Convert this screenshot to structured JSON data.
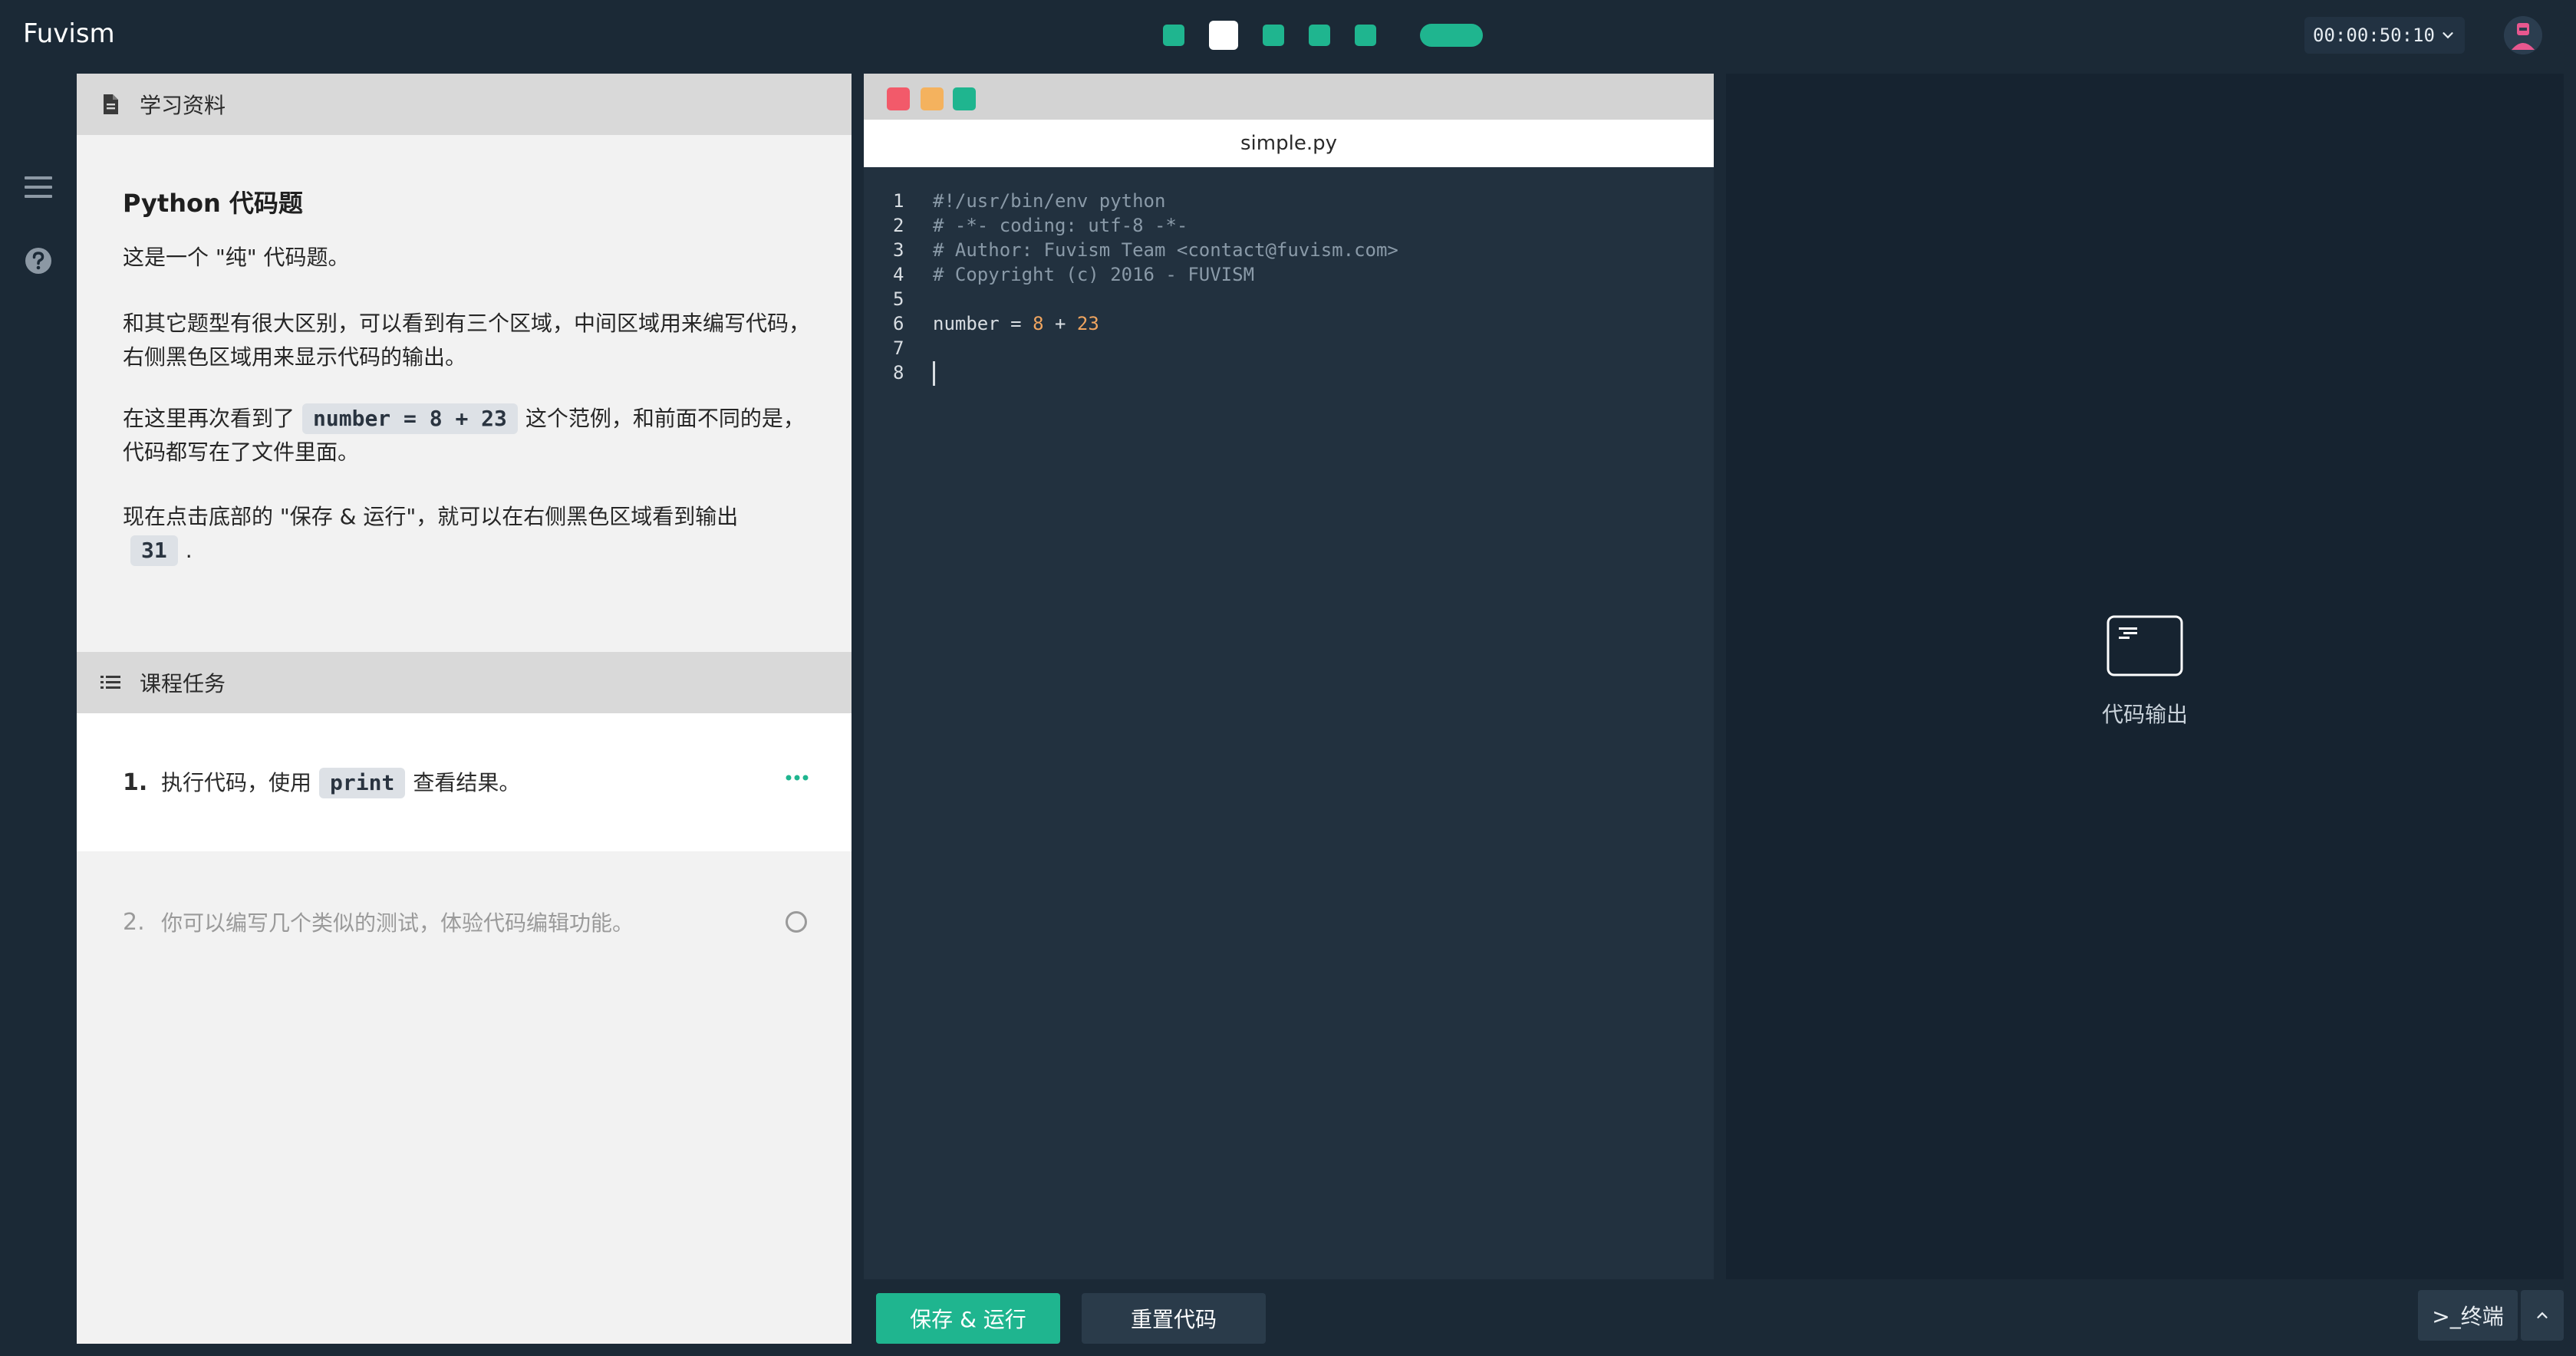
{
  "app": {
    "brand": "Fuvism"
  },
  "progress": {
    "steps_total": 6,
    "current_step": 2,
    "colors": {
      "done": "#1fb58f",
      "current": "#ffffff"
    }
  },
  "timer": {
    "value": "00:00:50:10"
  },
  "rail": {
    "icons": [
      "menu-icon",
      "help-icon"
    ]
  },
  "material": {
    "section_title": "学习资料",
    "title": "Python 代码题",
    "p1": "这是一个 \"纯\" 代码题。",
    "p2": "和其它题型有很大区别，可以看到有三个区域，中间区域用来编写代码，右侧黑色区域用来显示代码的输出。",
    "p3_before": "在这里再次看到了",
    "p3_code": "number = 8 + 23",
    "p3_after": "这个范例，和前面不同的是，代码都写在了文件里面。",
    "p4_before": "现在点击底部的 \"保存 & 运行\"，就可以在右侧黑色区域看到输出",
    "p4_code": "31",
    "p4_after": "."
  },
  "tasks": {
    "section_title": "课程任务",
    "items": [
      {
        "num": "1.",
        "text_before": "执行代码，使用",
        "code": "print",
        "text_after": "查看结果。",
        "status": "active"
      },
      {
        "num": "2.",
        "text": "你可以编写几个类似的测试，体验代码编辑功能。",
        "status": "pending"
      }
    ]
  },
  "editor": {
    "filename": "simple.py",
    "lines": [
      {
        "n": "1",
        "text": "#!/usr/bin/env python"
      },
      {
        "n": "2",
        "text": "# -*- coding: utf-8 -*-"
      },
      {
        "n": "3",
        "text": "# Author: Fuvism Team <contact@fuvism.com>"
      },
      {
        "n": "4",
        "text": "# Copyright (c) 2016 - FUVISM"
      },
      {
        "n": "5",
        "text": ""
      },
      {
        "n": "6",
        "code_name": "number",
        "code_eq": " = ",
        "code_a": "8",
        "code_plus": " + ",
        "code_b": "23"
      },
      {
        "n": "7",
        "text": ""
      },
      {
        "n": "8",
        "text": ""
      }
    ]
  },
  "output": {
    "label": "代码输出"
  },
  "actions": {
    "save_run": "保存 & 运行",
    "reset": "重置代码",
    "terminal": ">_终端"
  }
}
